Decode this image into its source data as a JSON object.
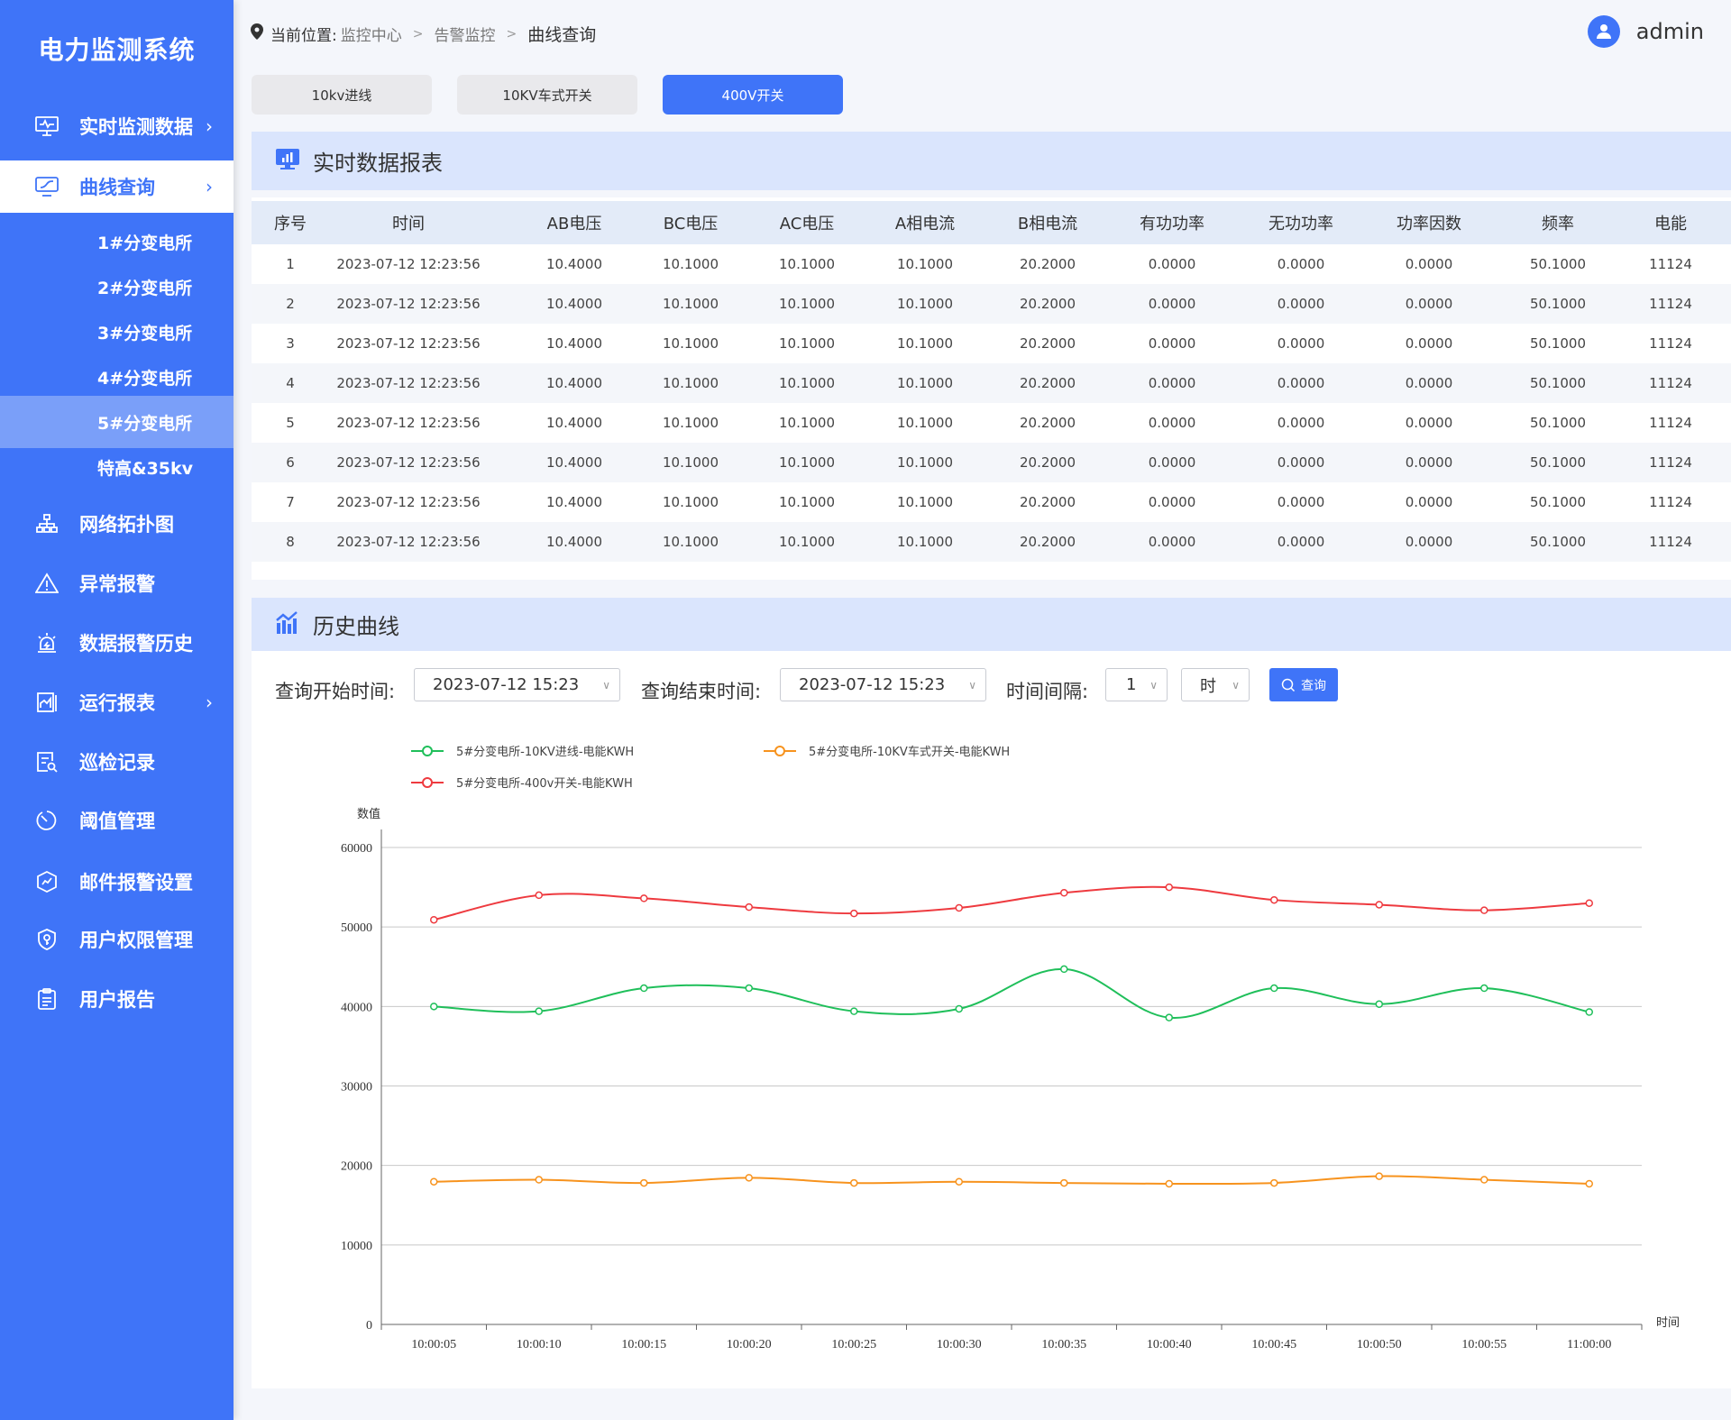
{
  "app": {
    "title": "电力监测系统"
  },
  "sidebar": {
    "items": [
      {
        "label": "实时监测数据",
        "icon": "monitor-pulse-icon",
        "arrow": "›"
      },
      {
        "label": "曲线查询",
        "icon": "monitor-chart-icon",
        "arrow": "›",
        "active": true
      },
      {
        "label": "网络拓扑图",
        "icon": "topology-icon"
      },
      {
        "label": "异常报警",
        "icon": "warning-triangle-icon"
      },
      {
        "label": "数据报警历史",
        "icon": "alarm-light-icon"
      },
      {
        "label": "运行报表",
        "icon": "report-chart-icon",
        "arrow": "›"
      },
      {
        "label": "巡检记录",
        "icon": "document-search-icon"
      },
      {
        "label": "阈值管理",
        "icon": "timer-icon"
      },
      {
        "label": "邮件报警设置",
        "icon": "shield-trend-icon"
      },
      {
        "label": "用户权限管理",
        "icon": "shield-key-icon"
      },
      {
        "label": "用户报告",
        "icon": "clipboard-icon"
      }
    ],
    "sub_items": [
      {
        "label": "1#分变电所"
      },
      {
        "label": "2#分变电所"
      },
      {
        "label": "3#分变电所"
      },
      {
        "label": "4#分变电所"
      },
      {
        "label": "5#分变电所",
        "active": true
      },
      {
        "label": "特高&35kv"
      }
    ]
  },
  "breadcrumb": {
    "prefix": "当前位置:",
    "items": [
      "监控中心",
      "告警监控",
      "曲线查询"
    ],
    "separator": ">"
  },
  "user": {
    "name": "admin"
  },
  "tabs": [
    {
      "label": "10kv进线"
    },
    {
      "label": "10KV车式开关"
    },
    {
      "label": "400V开关",
      "active": true
    }
  ],
  "realtime": {
    "title": "实时数据报表",
    "columns": [
      "序号",
      "时间",
      "AB电压",
      "BC电压",
      "AC电压",
      "A相电流",
      "B相电流",
      "有功功率",
      "无功功率",
      "功率因数",
      "频率",
      "电能"
    ],
    "rows": [
      [
        "1",
        "2023-07-12 12:23:56",
        "10.4000",
        "10.1000",
        "10.1000",
        "10.1000",
        "20.2000",
        "0.0000",
        "0.0000",
        "0.0000",
        "50.1000",
        "11124"
      ],
      [
        "2",
        "2023-07-12 12:23:56",
        "10.4000",
        "10.1000",
        "10.1000",
        "10.1000",
        "20.2000",
        "0.0000",
        "0.0000",
        "0.0000",
        "50.1000",
        "11124"
      ],
      [
        "3",
        "2023-07-12 12:23:56",
        "10.4000",
        "10.1000",
        "10.1000",
        "10.1000",
        "20.2000",
        "0.0000",
        "0.0000",
        "0.0000",
        "50.1000",
        "11124"
      ],
      [
        "4",
        "2023-07-12 12:23:56",
        "10.4000",
        "10.1000",
        "10.1000",
        "10.1000",
        "20.2000",
        "0.0000",
        "0.0000",
        "0.0000",
        "50.1000",
        "11124"
      ],
      [
        "5",
        "2023-07-12 12:23:56",
        "10.4000",
        "10.1000",
        "10.1000",
        "10.1000",
        "20.2000",
        "0.0000",
        "0.0000",
        "0.0000",
        "50.1000",
        "11124"
      ],
      [
        "6",
        "2023-07-12 12:23:56",
        "10.4000",
        "10.1000",
        "10.1000",
        "10.1000",
        "20.2000",
        "0.0000",
        "0.0000",
        "0.0000",
        "50.1000",
        "11124"
      ],
      [
        "7",
        "2023-07-12 12:23:56",
        "10.4000",
        "10.1000",
        "10.1000",
        "10.1000",
        "20.2000",
        "0.0000",
        "0.0000",
        "0.0000",
        "50.1000",
        "11124"
      ],
      [
        "8",
        "2023-07-12 12:23:56",
        "10.4000",
        "10.1000",
        "10.1000",
        "10.1000",
        "20.2000",
        "0.0000",
        "0.0000",
        "0.0000",
        "50.1000",
        "11124"
      ]
    ]
  },
  "history": {
    "title": "历史曲线",
    "start_label": "查询开始时间:",
    "start_value": "2023-07-12  15:23",
    "end_label": "查询结束时间:",
    "end_value": "2023-07-12  15:23",
    "interval_label": "时间间隔:",
    "interval_value": "1",
    "interval_unit": "时",
    "query_button": "查询",
    "chevron": "∨"
  },
  "chart_data": {
    "type": "line",
    "smooth": true,
    "title": "",
    "xlabel": "时间",
    "ylabel": "数值",
    "ylim": [
      0,
      60000
    ],
    "yticks": [
      0,
      10000,
      20000,
      30000,
      40000,
      50000,
      60000
    ],
    "grid": true,
    "legend_position": "top-left",
    "categories": [
      "10:00:05",
      "10:00:10",
      "10:00:15",
      "10:00:20",
      "10:00:25",
      "10:00:30",
      "10:00:35",
      "10:00:40",
      "10:00:45",
      "10:00:50",
      "10:00:55",
      "11:00:00"
    ],
    "series": [
      {
        "name": "5#分变电所-10KV进线-电能KWH",
        "color": "#1fbf5a",
        "values": [
          40000,
          39400,
          42300,
          42300,
          39400,
          39700,
          44700,
          38600,
          42300,
          40300,
          42300,
          39300
        ]
      },
      {
        "name": "5#分变电所-10KV车式开关-电能KWH",
        "color": "#f7931e",
        "values": [
          17950,
          18200,
          17800,
          18450,
          17800,
          17950,
          17800,
          17700,
          17800,
          18650,
          18200,
          17700
        ]
      },
      {
        "name": "5#分变电所-400v开关-电能KWH",
        "color": "#ee3a3f",
        "values": [
          50900,
          54000,
          53600,
          52500,
          51700,
          52400,
          54300,
          55000,
          53400,
          52800,
          52100,
          53000
        ]
      }
    ]
  }
}
